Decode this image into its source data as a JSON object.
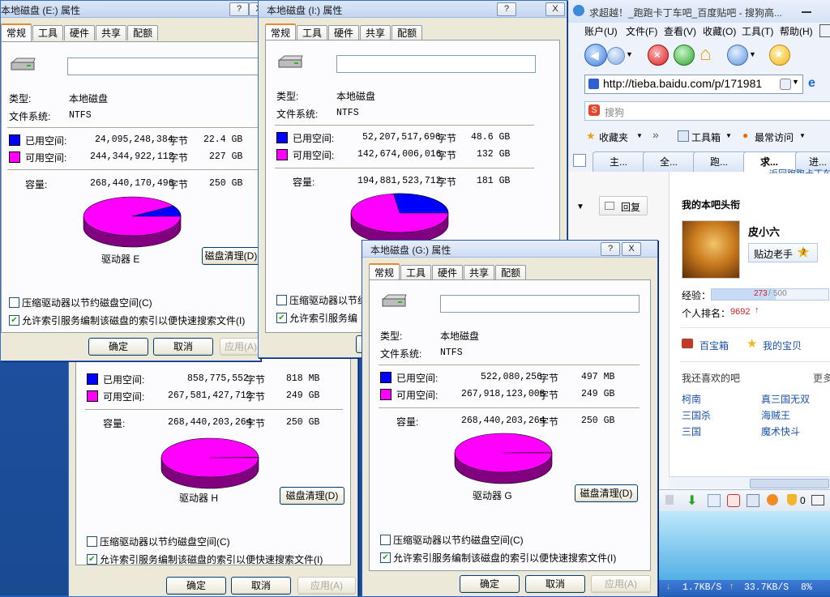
{
  "colors": {
    "used": "#0000ff",
    "free": "#ff00ff",
    "pie_edge_used": "#000080",
    "pie_edge_free": "#800080"
  },
  "tab_labels": [
    "常规",
    "工具",
    "硬件",
    "共享",
    "配额"
  ],
  "common": {
    "type_label": "类型:",
    "type_value": "本地磁盘",
    "fs_label": "文件系统:",
    "fs_value": "NTFS",
    "used_label": "已用空间:",
    "free_label": "可用空间:",
    "cap_label": "容量:",
    "bytes_unit": "字节",
    "cleanup": "磁盘清理(D)",
    "compress": "压缩驱动器以节约磁盘空间(C)",
    "index": "允许索引服务编制该磁盘的索引以便快速搜索文件(I)",
    "index_short": "允许索引服务编",
    "ok": "确定",
    "cancel": "取消",
    "apply": "应用(A)",
    "help": "?",
    "close": "X"
  },
  "dialogE": {
    "title": "本地磁盘 (E:) 属性",
    "used_bytes": "24,095,248,384",
    "used_size": "22.4 GB",
    "free_bytes": "244,344,922,112",
    "free_size": "227 GB",
    "cap_bytes": "268,440,170,496",
    "cap_size": "250 GB",
    "drive": "驱动器 E",
    "used_frac": 0.09
  },
  "dialogI": {
    "title": "本地磁盘 (I:) 属性",
    "used_bytes": "52,207,517,696",
    "used_size": "48.6 GB",
    "free_bytes": "142,674,006,016",
    "free_size": "132 GB",
    "cap_bytes": "194,881,523,712",
    "cap_size": "181 GB",
    "used_frac": 0.27
  },
  "dialogH": {
    "used_bytes": "858,775,552",
    "used_size": "818 MB",
    "free_bytes": "267,581,427,712",
    "free_size": "249 GB",
    "cap_bytes": "268,440,203,264",
    "cap_size": "250 GB",
    "drive": "驱动器 H",
    "used_frac": 0.003
  },
  "dialogG": {
    "title": "本地磁盘 (G:) 属性",
    "used_bytes": "522,080,256",
    "used_size": "497 MB",
    "free_bytes": "267,918,123,008",
    "free_size": "249 GB",
    "cap_bytes": "268,440,203,264",
    "cap_size": "250 GB",
    "drive": "驱动器 G",
    "used_frac": 0.002
  },
  "browser": {
    "title": "求超越！_跑跑卡丁车吧_百度贴吧 - 搜狗高...",
    "menu": [
      "账户(U)",
      "文件(F)",
      "查看(V)",
      "收藏(O)",
      "工具(T)",
      "帮助(H)"
    ],
    "url": "http://tieba.baidu.com/p/171981",
    "search_placeholder": "搜狗",
    "favorites": "收藏夹",
    "toolbox": "工具箱",
    "most_visited": "最常访问",
    "tabs": [
      "主...",
      "全...",
      "跑...",
      "求...",
      "进..."
    ],
    "top_cut": "返回跑跑卡丁车",
    "reply": "回复",
    "my_title": "我的本吧头衔",
    "username": "皮小六",
    "rank_title": "贴边老手",
    "level": "7",
    "exp_label": "经验：",
    "exp_cur": "273",
    "exp_sep": "/",
    "exp_max": "500",
    "exp_frac": 0.546,
    "ranking_label": "个人排名：",
    "ranking": "9692",
    "treasure": "百宝箱",
    "my_treasure": "我的宝贝",
    "also_like": "我还喜欢的吧",
    "more": "更多",
    "likes": [
      "柯南",
      "真三国无双",
      "三国杀",
      "海贼王",
      "三国",
      "魔术快斗"
    ],
    "down_speed": "1.7KB/S",
    "up_speed": "33.7KB/S",
    "cpu": "8%",
    "badge_num": "0"
  }
}
